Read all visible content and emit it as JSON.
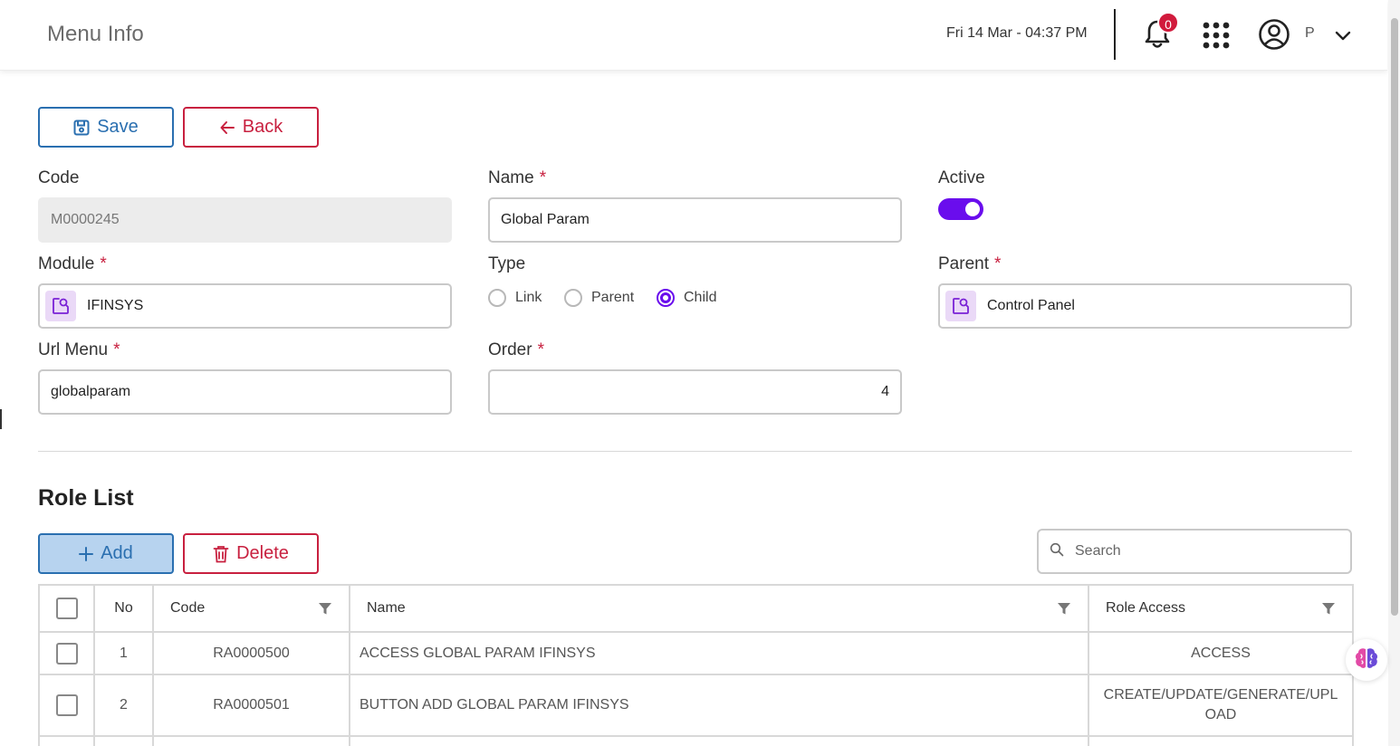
{
  "header": {
    "title": "Menu Info",
    "datetime": "Fri 14 Mar - 04:37 PM",
    "notification_count": "0",
    "user_initial": "P"
  },
  "toolbar": {
    "save_label": "Save",
    "back_label": "Back"
  },
  "form": {
    "code": {
      "label": "Code",
      "value": "M0000245"
    },
    "name": {
      "label": "Name",
      "required": "*",
      "value": "Global Param"
    },
    "active": {
      "label": "Active",
      "checked": true
    },
    "module": {
      "label": "Module",
      "required": "*",
      "value": "IFINSYS"
    },
    "type": {
      "label": "Type",
      "options": [
        "Link",
        "Parent",
        "Child"
      ],
      "selected": "Child"
    },
    "parent": {
      "label": "Parent",
      "required": "*",
      "value": "Control Panel"
    },
    "url_menu": {
      "label": "Url Menu",
      "required": "*",
      "value": "globalparam"
    },
    "order": {
      "label": "Order",
      "required": "*",
      "value": "4"
    }
  },
  "role_list": {
    "title": "Role List",
    "add_label": "Add",
    "delete_label": "Delete",
    "search_placeholder": "Search",
    "columns": [
      "No",
      "Code",
      "Name",
      "Role Access"
    ],
    "rows": [
      {
        "no": "1",
        "code": "RA0000500",
        "name": "ACCESS GLOBAL PARAM IFINSYS",
        "role_access": "ACCESS"
      },
      {
        "no": "2",
        "code": "RA0000501",
        "name": "BUTTON ADD GLOBAL PARAM IFINSYS",
        "role_access": "CREATE/UPDATE/GENERATE/UPLOAD"
      }
    ]
  },
  "colors": {
    "primary_blue": "#2a6fb0",
    "danger_red": "#c8203f",
    "accent_purple": "#6a0ded",
    "badge_red": "#d11a3c"
  },
  "icons": [
    "bell-icon",
    "apps-grid-icon",
    "user-circle-icon",
    "chevron-down-icon",
    "save-icon",
    "arrow-left-icon",
    "lookup-icon",
    "plus-icon",
    "trash-icon",
    "search-icon",
    "filter-icon",
    "brain-icon"
  ]
}
